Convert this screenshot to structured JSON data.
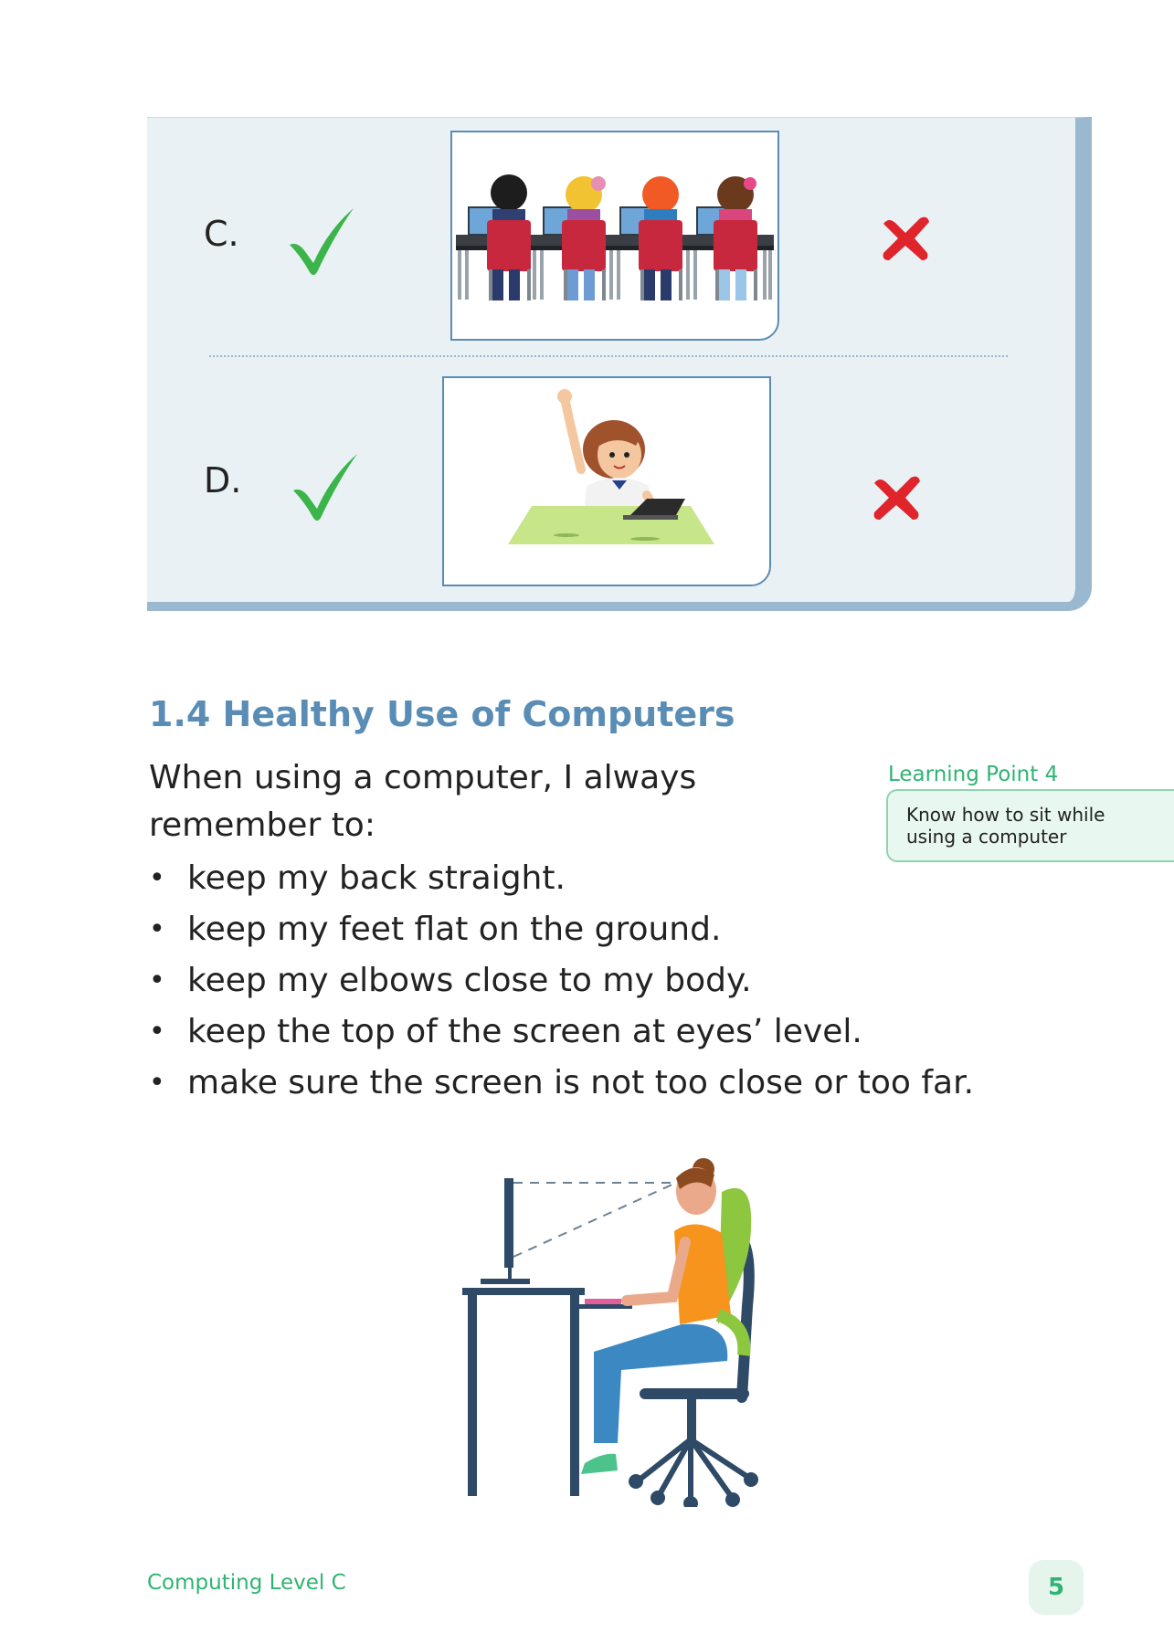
{
  "rows": [
    {
      "letter": "C.",
      "icon_correct": "check-icon",
      "icon_wrong": "cross-icon"
    },
    {
      "letter": "D.",
      "icon_correct": "check-icon",
      "icon_wrong": "cross-icon"
    }
  ],
  "section": {
    "title": "1.4 Healthy Use of Computers",
    "intro": "When using a computer, I always remember to:",
    "bullets": [
      "keep my back straight.",
      "keep my feet flat on the ground.",
      "keep my elbows close to my body.",
      "keep the top of the screen at eyes’ level.",
      "make sure the screen is not too close or too far."
    ]
  },
  "learning_point": {
    "title": "Learning Point 4",
    "text_line1": "Know how to sit while",
    "text_line2": "using a computer"
  },
  "footer": {
    "book": "Computing Level C",
    "page": "5"
  },
  "colors": {
    "heading": "#5a8db5",
    "green": "#2fb373",
    "check": "#3bb54a",
    "cross": "#e0242c",
    "panel": "#eaf1f5"
  }
}
